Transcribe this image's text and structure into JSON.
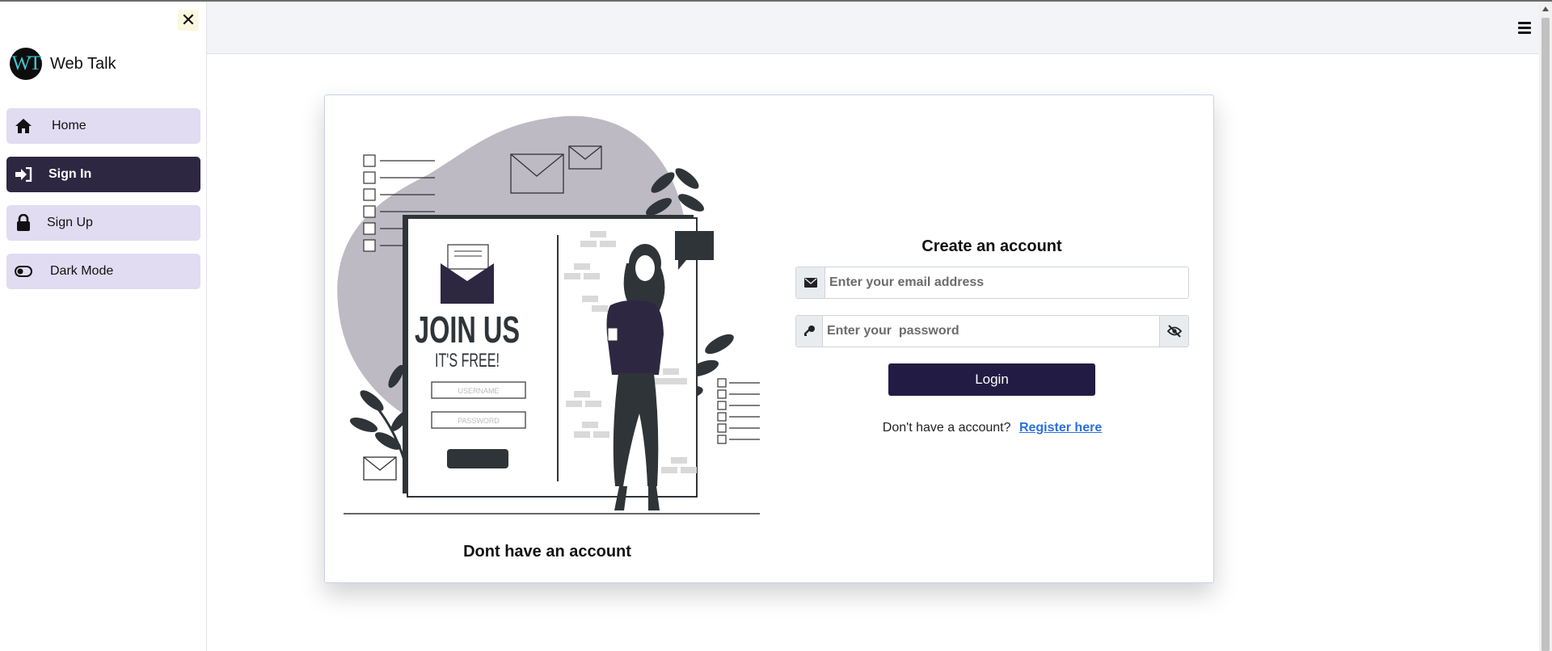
{
  "sidebar": {
    "close_icon": "close-icon",
    "brand": {
      "logo_text": "WT",
      "name": "Web Talk"
    },
    "items": [
      {
        "label": "Home",
        "icon": "home-icon",
        "active": false
      },
      {
        "label": "Sign In",
        "icon": "sign-in-icon",
        "active": true
      },
      {
        "label": "Sign Up",
        "icon": "lock-icon",
        "active": false
      },
      {
        "label": "Dark Mode",
        "icon": "toggle-icon",
        "active": false
      }
    ]
  },
  "header": {
    "menu_icon": "hamburger-icon"
  },
  "illustration": {
    "heading": "JOIN US",
    "subheading": "IT'S FREE!",
    "username_field": "USERNAME",
    "password_field": "PASSWORD"
  },
  "card": {
    "caption": "Dont have an account"
  },
  "form": {
    "title": "Create an account",
    "email_placeholder": "Enter your email address",
    "email_icon": "envelope-icon",
    "password_placeholder": "Enter your  password",
    "password_icon": "key-icon",
    "toggle_visibility_icon": "eye-slash-icon",
    "login_label": "Login",
    "register_prompt": "Don't have a account?",
    "register_link": "Register here"
  },
  "colors": {
    "sidebar_item_bg": "#e1dcf1",
    "sidebar_active_bg": "#2e2742",
    "login_button_bg": "#221c44",
    "link": "#2b6fe0",
    "header_bg": "#f2f4f8"
  }
}
